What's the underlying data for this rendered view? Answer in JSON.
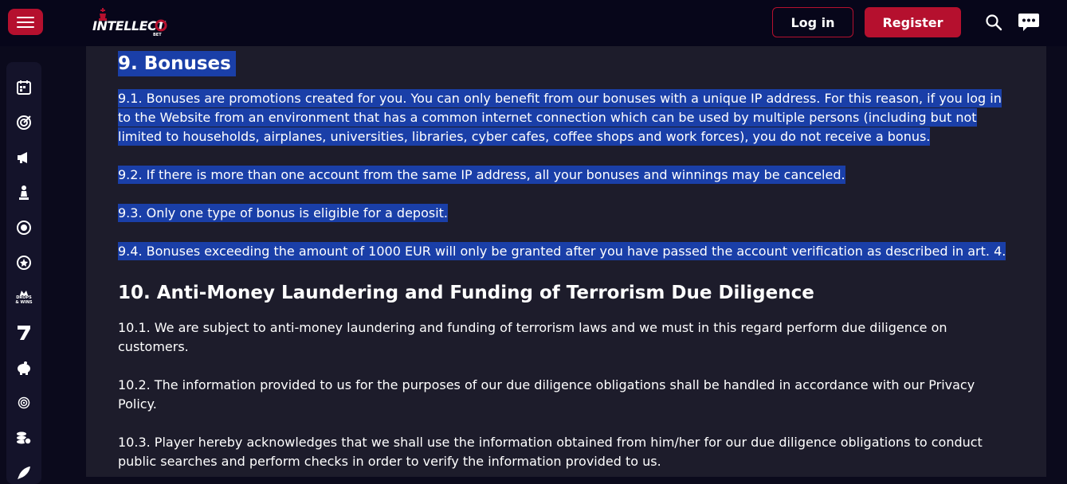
{
  "header": {
    "logo_text": "INTELLECT",
    "logo_sub": "BET",
    "login_label": "Log in",
    "register_label": "Register",
    "accent_color": "#b5102e"
  },
  "sidebar": {
    "icons": [
      "calendar-icon",
      "target-icon",
      "megaphone-icon",
      "chess-icon",
      "roulette-icon",
      "star-coin-icon",
      "drops-wins-icon",
      "seven-icon",
      "piggy-bank-icon",
      "radar-icon",
      "coins-icon",
      "rocket-icon"
    ],
    "drops_wins_label": "DROPS & WINS"
  },
  "document": {
    "section9_title": "9. Bonuses",
    "p9_1": "9.1. Bonuses are promotions created for you. You can only benefit from our bonuses with a unique IP address. For this reason, if you log in to the Website from an environment that has a common internet connection which can be used by multiple persons (including but not limited to households, airplanes, universities, libraries, cyber cafes, coffee shops and work forces), you do not receive a bonus.",
    "p9_2": "9.2. If there is more than one account from the same IP address, all your bonuses and winnings may be canceled.",
    "p9_3": "9.3. Only one type of bonus is eligible for a deposit.",
    "p9_4": "9.4. Bonuses exceeding the amount of 1000 EUR will only be granted after you have passed the account verification as described in art. 4.",
    "section10_title": "10. Anti-Money Laundering and Funding of Terrorism Due Diligence",
    "p10_1": "10.1. We are subject to anti-money laundering and funding of terrorism laws and we must in this regard perform due diligence on customers.",
    "p10_2": "10.2. The information provided to us for the purposes of our due diligence obligations shall be handled in accordance with our Privacy Policy.",
    "p10_3": "10.3. Player hereby acknowledges that we shall use the information obtained from him/her for our due diligence obligations to conduct public searches and perform checks in order to verify the information provided to us."
  }
}
